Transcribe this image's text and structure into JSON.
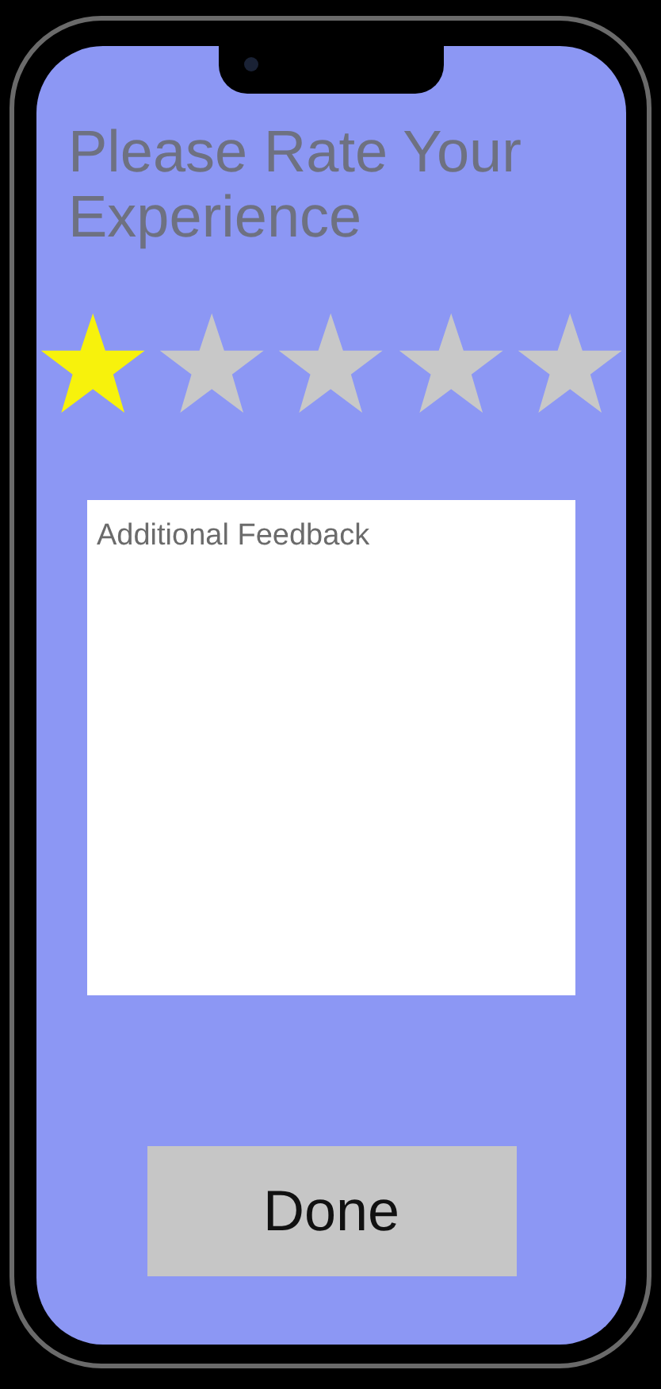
{
  "title": "Please Rate Your Experience",
  "rating": {
    "stars": 1
  },
  "feedback": {
    "placeholder": "Additional Feedback"
  },
  "done_button": {
    "label": "Done"
  }
}
